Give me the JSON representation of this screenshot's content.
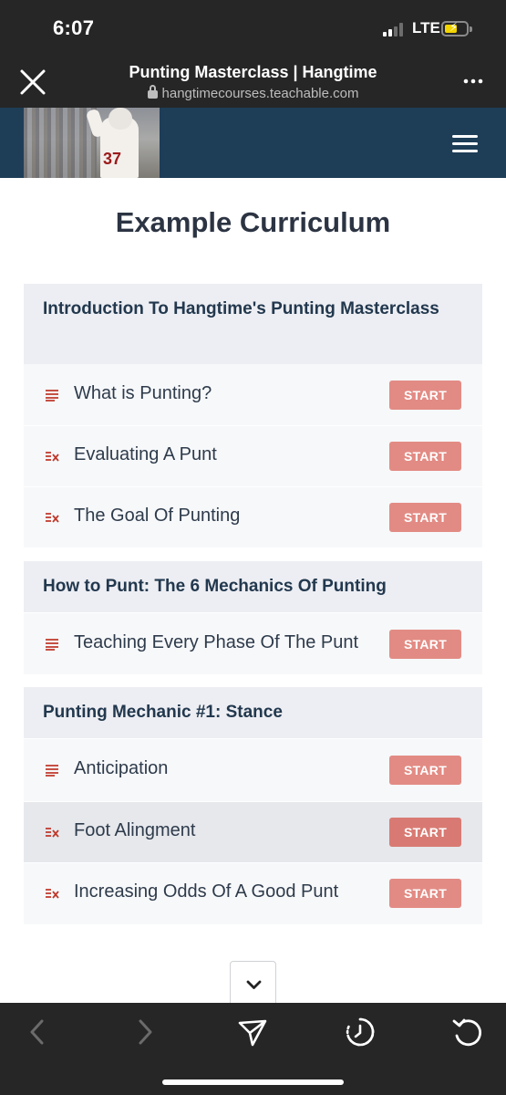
{
  "status_bar": {
    "time": "6:07",
    "network": "LTE"
  },
  "browser": {
    "page_title": "Punting Masterclass | Hangtime",
    "url": "hangtimecourses.teachable.com"
  },
  "site_header": {
    "hero_jersey_number": "37"
  },
  "curriculum": {
    "heading": "Example Curriculum",
    "start_label": "START",
    "sections": [
      {
        "title": "Introduction To Hangtime's Punting Masterclass",
        "lectures": [
          {
            "title": "What is Punting?",
            "icon": "text-lines-icon"
          },
          {
            "title": "Evaluating A Punt",
            "icon": "quiz-icon"
          },
          {
            "title": "The Goal Of Punting",
            "icon": "quiz-icon"
          }
        ]
      },
      {
        "title": "How to Punt: The 6 Mechanics Of Punting",
        "lectures": [
          {
            "title": "Teaching Every Phase Of The Punt",
            "icon": "text-lines-icon"
          }
        ]
      },
      {
        "title": "Punting Mechanic #1: Stance",
        "lectures": [
          {
            "title": "Anticipation",
            "icon": "text-lines-icon"
          },
          {
            "title": "Foot Alingment",
            "icon": "quiz-icon"
          },
          {
            "title": "Increasing Odds Of A Good Punt",
            "icon": "quiz-icon"
          }
        ]
      }
    ]
  },
  "colors": {
    "header_bg": "#1e3d57",
    "start_button": "#e28b84",
    "icon_accent": "#c0392b",
    "section_bg": "#edeef3",
    "lecture_bg": "#f7f8fa"
  },
  "toolbar": {
    "icons": [
      "back-arrow-icon",
      "forward-arrow-icon",
      "share-send-icon",
      "history-timer-icon",
      "reload-icon"
    ]
  }
}
